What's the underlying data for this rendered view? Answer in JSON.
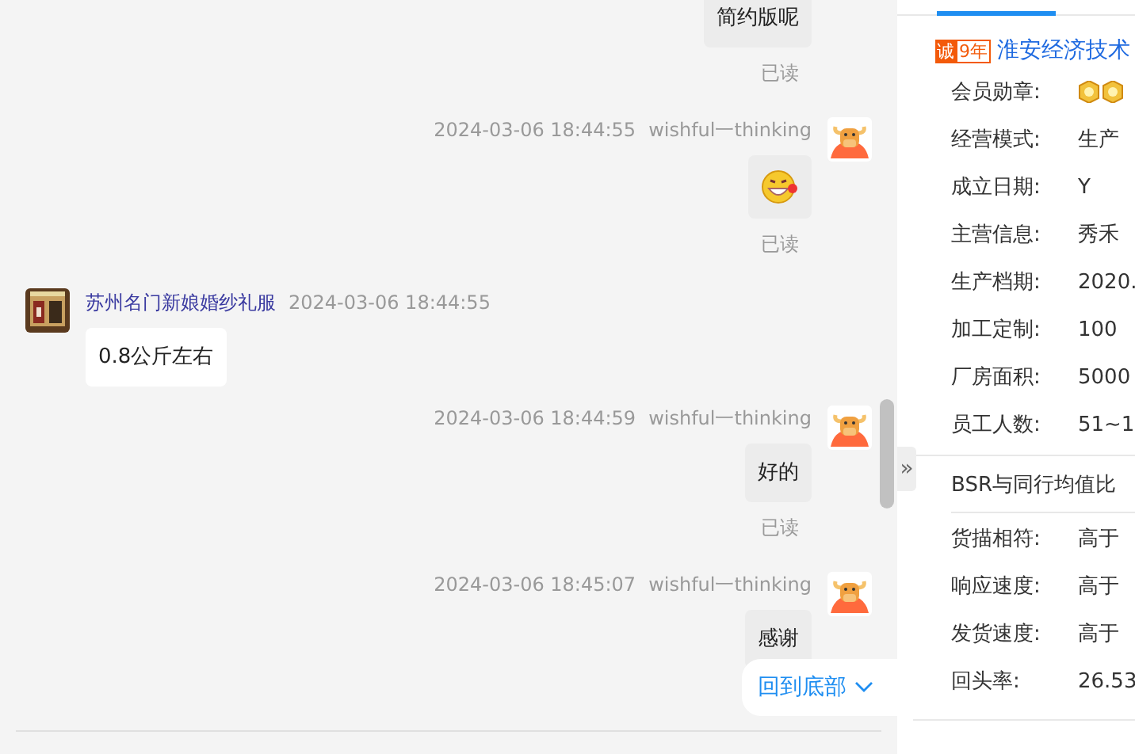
{
  "messages": [
    {
      "outgoing": true,
      "kind": "text",
      "text": "简约版呢",
      "read_label": "已读"
    },
    {
      "outgoing": true,
      "kind": "emoji",
      "time": "2024-03-06 18:44:55",
      "sender": "wishful一thinking",
      "read_label": "已读"
    },
    {
      "outgoing": false,
      "kind": "text",
      "time": "2024-03-06 18:44:55",
      "sender": "苏州名门新娘婚纱礼服",
      "text": "0.8公斤左右"
    },
    {
      "outgoing": true,
      "kind": "text",
      "time": "2024-03-06 18:44:59",
      "sender": "wishful一thinking",
      "text": "好的",
      "read_label": "已读"
    },
    {
      "outgoing": true,
      "kind": "text",
      "time": "2024-03-06 18:45:07",
      "sender": "wishful一thinking",
      "text": "感谢"
    }
  ],
  "jump_button": "回到底部",
  "expand_button": "»",
  "shop": {
    "badge_mark": "诚",
    "years": "9年",
    "name": "淮安经济技术",
    "fields": [
      {
        "label": "会员勋章:",
        "kind": "medals"
      },
      {
        "label": "经营模式:",
        "value": "生产"
      },
      {
        "label": "成立日期:",
        "value": "Y"
      },
      {
        "label": "主营信息:",
        "value": "秀禾"
      },
      {
        "label": "生产档期:",
        "value": "2020."
      },
      {
        "label": "加工定制:",
        "value": "100"
      },
      {
        "label": "厂房面积:",
        "value": "5000"
      },
      {
        "label": "员工人数:",
        "value": "51~1"
      }
    ],
    "bsr_title": "BSR与同行均值比",
    "bsr_fields": [
      {
        "label": "货描相符:",
        "value": "高于"
      },
      {
        "label": "响应速度:",
        "value": "高于"
      },
      {
        "label": "发货速度:",
        "value": "高于"
      },
      {
        "label": "回头率:",
        "value": "26.53"
      }
    ]
  }
}
